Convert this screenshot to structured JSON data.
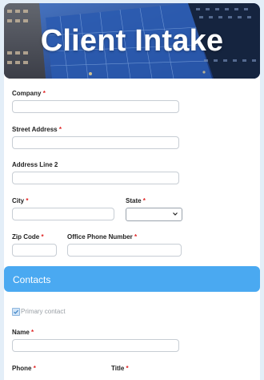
{
  "header": {
    "title": "Client Intake"
  },
  "form": {
    "company": {
      "label": "Company",
      "required_mark": "*"
    },
    "street_address": {
      "label": "Street Address",
      "required_mark": "*"
    },
    "address_line2": {
      "label": "Address Line 2"
    },
    "city": {
      "label": "City",
      "required_mark": "*"
    },
    "state": {
      "label": "State",
      "required_mark": "*"
    },
    "zip": {
      "label": "Zip Code",
      "required_mark": "*"
    },
    "office_phone": {
      "label": "Office Phone Number",
      "required_mark": "*"
    }
  },
  "contacts": {
    "section_title": "Contacts",
    "primary_contact_label": "Primary contact",
    "primary_contact_checked": true,
    "name": {
      "label": "Name",
      "required_mark": "*"
    },
    "phone": {
      "label": "Phone",
      "required_mark": "*"
    },
    "title": {
      "label": "Title",
      "required_mark": "*"
    }
  },
  "colors": {
    "accent": "#4aa9f1",
    "required": "#e02424"
  },
  "icons": {
    "chevron": "chevron-down-icon",
    "check": "check-icon"
  }
}
